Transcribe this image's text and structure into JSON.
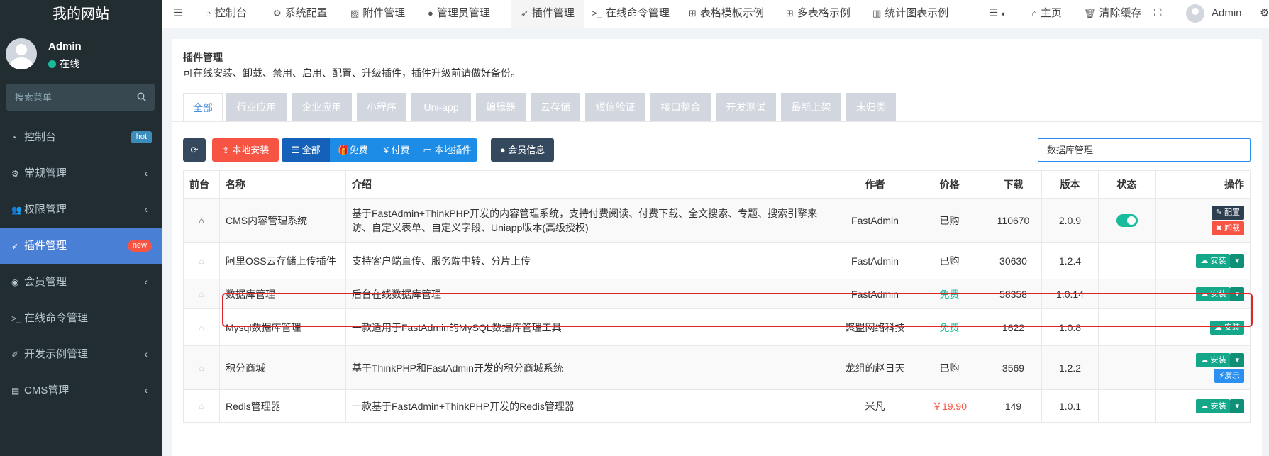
{
  "sidebar": {
    "logo": "我的网站",
    "user": {
      "name": "Admin",
      "status": "在线"
    },
    "search_placeholder": "搜索菜单",
    "items": [
      {
        "label": "控制台",
        "icon": "dashboard-icon",
        "badge": "hot"
      },
      {
        "label": "常规管理",
        "icon": "cogs-icon"
      },
      {
        "label": "权限管理",
        "icon": "group-icon"
      },
      {
        "label": "插件管理",
        "icon": "rocket-icon",
        "badge": "new",
        "active": true
      },
      {
        "label": "会员管理",
        "icon": "user-circle-icon"
      },
      {
        "label": "在线命令管理",
        "icon": "terminal-icon"
      },
      {
        "label": "开发示例管理",
        "icon": "magic-icon"
      },
      {
        "label": "CMS管理",
        "icon": "file-icon"
      }
    ]
  },
  "topnav": {
    "tabs": [
      "控制台",
      "系统配置",
      "附件管理",
      "管理员管理",
      "插件管理",
      "在线命令管理",
      "表格模板示例",
      "多表格示例",
      "统计图表示例"
    ],
    "home": "主页",
    "clear_cache": "清除缓存",
    "user": "Admin"
  },
  "page": {
    "title": "插件管理",
    "description": "可在线安装、卸载、禁用、启用、配置、升级插件，插件升级前请做好备份。",
    "categories": [
      "全部",
      "行业应用",
      "企业应用",
      "小程序",
      "Uni-app",
      "编辑器",
      "云存储",
      "短信验证",
      "接口整合",
      "开发测试",
      "最新上架",
      "未归类"
    ]
  },
  "toolbar": {
    "local_install": "本地安装",
    "all": "全部",
    "free": "免费",
    "paid": "付费",
    "local_plugins": "本地插件",
    "member_info": "会员信息",
    "search_value": "数据库管理"
  },
  "table": {
    "headers": {
      "frontend": "前台",
      "name": "名称",
      "intro": "介绍",
      "author": "作者",
      "price": "价格",
      "downloads": "下载",
      "version": "版本",
      "status": "状态",
      "actions": "操作"
    },
    "rows": [
      {
        "name": "CMS内容管理系统",
        "intro": "基于FastAdmin+ThinkPHP开发的内容管理系统，支持付费阅读、付费下载、全文搜索、专题、搜索引擎来访、自定义表单、自定义字段、Uniapp版本(高级授权)",
        "author": "FastAdmin",
        "price": "已购",
        "downloads": "110670",
        "version": "2.0.9"
      },
      {
        "name": "阿里OSS云存储上传插件",
        "intro": "支持客户端直传、服务端中转、分片上传",
        "author": "FastAdmin",
        "price": "已购",
        "downloads": "30630",
        "version": "1.2.4"
      },
      {
        "name": "数据库管理",
        "intro": "后台在线数据库管理",
        "author": "FastAdmin",
        "price": "免费",
        "downloads": "58358",
        "version": "1.0.14"
      },
      {
        "name": "Mysql数据库管理",
        "intro": "一款适用于FastAdmin的MySQL数据库管理工具",
        "author": "聚盟网络科技",
        "price": "免费",
        "downloads": "1622",
        "version": "1.0.8"
      },
      {
        "name": "积分商城",
        "intro": "基于ThinkPHP和FastAdmin开发的积分商城系统",
        "author": "龙组的赵日天",
        "price": "已购",
        "downloads": "3569",
        "version": "1.2.2"
      },
      {
        "name": "Redis管理器",
        "intro": "一款基于FastAdmin+ThinkPHP开发的Redis管理器",
        "author": "米凡",
        "price": "￥19.90",
        "downloads": "149",
        "version": "1.0.1"
      }
    ],
    "actions": {
      "config": "配置",
      "uninstall": "卸载",
      "install": "安装",
      "demo": "演示"
    }
  }
}
